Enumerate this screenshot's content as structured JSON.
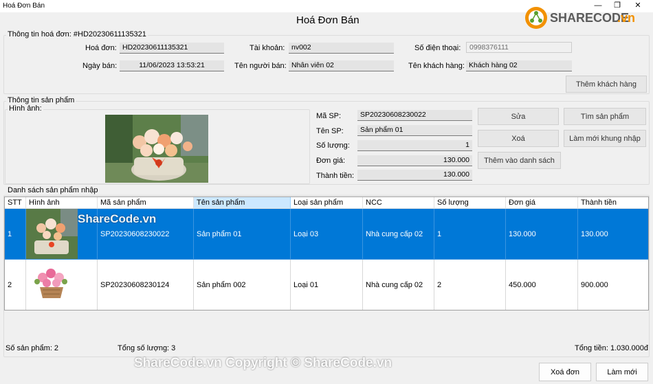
{
  "window": {
    "title": "Hoá Đơn Bán",
    "min_glyph": "—",
    "max_glyph": "❐",
    "close_glyph": "✕"
  },
  "logo": {
    "text_share": "SHARECODE",
    "text_vn": ".vn"
  },
  "form_title": "Hoá Đơn Bán",
  "invoice_group": {
    "label": "Thông tin hoá đơn: #HD20230611135321",
    "hoa_don_label": "Hoá đơn:",
    "hoa_don_value": "HD20230611135321",
    "ngay_ban_label": "Ngày bán:",
    "ngay_ban_value": "11/06/2023 13:53:21",
    "tai_khoan_label": "Tài khoản:",
    "tai_khoan_value": "nv002",
    "ten_nguoi_ban_label": "Tên người bán:",
    "ten_nguoi_ban_value": "Nhân viên 02",
    "sdt_label": "Số điện thoại:",
    "sdt_value": "0998376111",
    "ten_khach_label": "Tên khách hàng:",
    "ten_khach_value": "Khách hàng 02",
    "them_khach_button": "Thêm khách hàng"
  },
  "product_group": {
    "label": "Thông tin sản phẩm",
    "image_label": "Hình ảnh:",
    "ma_sp_label": "Mã SP:",
    "ma_sp_value": "SP20230608230022",
    "ten_sp_label": "Tên SP:",
    "ten_sp_value": "Sản phẩm 01",
    "so_luong_label": "Số lượng:",
    "so_luong_value": "1",
    "don_gia_label": "Đơn giá:",
    "don_gia_value": "130.000",
    "thanh_tien_label": "Thành tiền:",
    "thanh_tien_value": "130.000",
    "sua_button": "Sửa",
    "xoa_button": "Xoá",
    "them_vao_button": "Thêm vào danh sách",
    "tim_button": "Tìm sản phẩm",
    "lam_moi_khung_button": "Làm mới khung nhập"
  },
  "list_group": {
    "label": "Danh sách sản phẩm nhập",
    "columns": [
      "STT",
      "Hình ảnh",
      "Mã sản phẩm",
      "Tên sản phẩm",
      "Loại sản phẩm",
      "NCC",
      "Số lượng",
      "Đơn giá",
      "Thành tiền"
    ],
    "rows": [
      {
        "stt": "1",
        "ma": "SP20230608230022",
        "ten": "Sản phẩm 01",
        "loai": "Loại 03",
        "ncc": "Nhà cung cấp 02",
        "so_luong": "1",
        "don_gia": "130.000",
        "thanh_tien": "130.000"
      },
      {
        "stt": "2",
        "ma": "SP20230608230124",
        "ten": "Sản phẩm 002",
        "loai": "Loại 01",
        "ncc": "Nhà cung cấp 02",
        "so_luong": "2",
        "don_gia": "450.000",
        "thanh_tien": "900.000"
      }
    ],
    "so_san_pham": "Số sản phẩm: 2",
    "tong_so_luong": "Tổng số lượng: 3",
    "tong_tien": "Tổng tiền: 1.030.000đ"
  },
  "footer": {
    "xoa_don_button": "Xoá đơn",
    "lam_moi_button": "Làm mới"
  },
  "watermarks": {
    "grid": "ShareCode.vn",
    "copyright": "ShareCode.vn Copyright © ShareCode.vn"
  },
  "colors": {
    "selection": "#0078d7",
    "header_selected": "#cce8ff",
    "logo_orange": "#f29100"
  }
}
